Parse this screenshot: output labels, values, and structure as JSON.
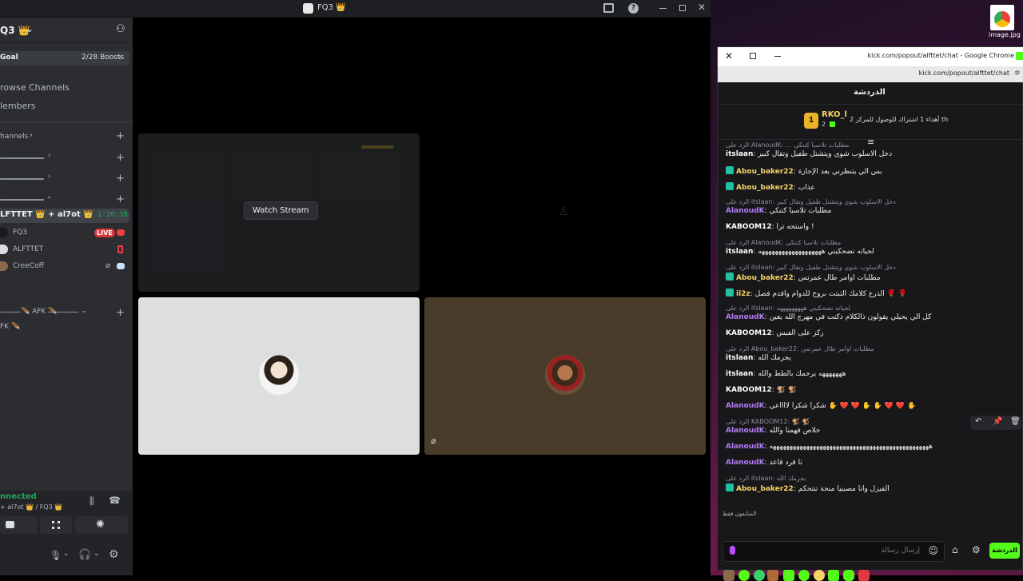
{
  "discord": {
    "window_title": "FQ3 👑",
    "server_name": "Q3 👑",
    "goal_label": "Goal",
    "boosts_label": "2/28 Boosts",
    "browse_channels": "rowse Channels",
    "members": "lembers",
    "channels_header": "hannels",
    "afk_header": "🪶 AFK 🪶",
    "afk_channel": "FK 🪶",
    "voice_channel": {
      "name": "LFTTET 👑 + al7ot 👑",
      "timer": "1:20:38",
      "members": [
        {
          "name": "FQ3",
          "live": "LIVE"
        },
        {
          "name": "ALFTTET"
        },
        {
          "name": "CreeCoff"
        }
      ]
    },
    "connection": {
      "status": "nnected",
      "detail": "+ al7ot 👑 / FQ3 👑"
    },
    "watch_stream": "Watch Stream"
  },
  "desktop": {
    "file_label": "image.jpg"
  },
  "chrome": {
    "window_title": "kick.com/popout/alfttet/chat - Google Chrome",
    "url": "kick.com/popout/alfttet/chat",
    "chat_title": "الدردشة",
    "pinned_user": "RKO_l",
    "pinned_rank": "1",
    "pinned_count": "2",
    "pinned_text": "أهداء 1 اشتراك للوصول للمركز 2 th",
    "messages": [
      {
        "type": "reply",
        "text": "الرد على AlanoudK: ... مطلبات تلاسبا كتنكي"
      },
      {
        "type": "msg",
        "user": "itslaan",
        "color": "#ffffff",
        "text": "دخل الاسلوب شوي ويتشتل طفيل وتقال كبير"
      },
      {
        "type": "msg",
        "user": "Abou_baker22",
        "color": "#f6d365",
        "badge": true,
        "text": "بس الي يتنظرني بعد الإجازة"
      },
      {
        "type": "msg",
        "user": "Abou_baker22",
        "color": "#f6d365",
        "badge": true,
        "text": "عذاب"
      },
      {
        "type": "reply",
        "text": "الرد على itslaan: دخل الاسلوب شوي ويتشتل طفيل وتقال كبير"
      },
      {
        "type": "msg",
        "user": "AlanoudK",
        "color": "#b27cf5",
        "text": "مطلبات تلاسبا كتنكي"
      },
      {
        "type": "msg",
        "user": "KABOOM12",
        "color": "#ffffff",
        "text": "واستحه ترا !"
      },
      {
        "type": "reply",
        "text": "الرد على AlanoudK: مطلبات تلاسبا كتنكي"
      },
      {
        "type": "msg",
        "user": "itslaan",
        "color": "#ffffff",
        "text": "لحياته تضحكيني هههههههههههههههههههه"
      },
      {
        "type": "reply",
        "text": "الرد على itslaan: دخل الاسلوب شوي ويتشتل طفيل وتقال كبير"
      },
      {
        "type": "msg",
        "user": "Abou_baker22",
        "color": "#f6d365",
        "badge": true,
        "text": "مطلبات اوامر طال عمرتس"
      },
      {
        "type": "msg",
        "user": "ii2z",
        "color": "#f6d365",
        "badge": true,
        "text": "الذرع كلامك الثبتت بروح للدوام واقدم فصل 🌹 🌹"
      },
      {
        "type": "reply",
        "text": "الرد على itslaan: لحياته تضحكيني هههههههههه"
      },
      {
        "type": "msg",
        "user": "AlanoudK",
        "color": "#b27cf5",
        "text": "كل الي يحيلي يقولون ذالكلام ذكتت في مهرج الله يعين"
      },
      {
        "type": "msg",
        "user": "KABOOM12",
        "color": "#ffffff",
        "text": "ركز على الفيس"
      },
      {
        "type": "reply",
        "text": "الرد على Abou_baker22: مطلبات اوامر طال عمرتس"
      },
      {
        "type": "msg",
        "user": "itslaan",
        "color": "#ffffff",
        "text": "يحرمك الله"
      },
      {
        "type": "msg",
        "user": "itslaan",
        "color": "#ffffff",
        "text": "هههههههه يرحمك بالطط والله"
      },
      {
        "type": "msg",
        "user": "KABOOM12",
        "color": "#ffffff",
        "text": "🐒 🐒"
      },
      {
        "type": "msg",
        "user": "AlanoudK",
        "color": "#b27cf5",
        "text": "شكراً شكراً لااااعي ✋ ❤️ ❤️ ✋ ✋ ❤️ ❤️ ✋"
      },
      {
        "type": "reply",
        "text": "الرد على KABOOM12: 🐒 🐒"
      },
      {
        "type": "msg",
        "user": "AlanoudK",
        "color": "#b27cf5",
        "text": "خلاص فهمنا والله"
      },
      {
        "type": "msg",
        "user": "AlanoudK",
        "color": "#b27cf5",
        "text": "ههههههههههههههههههههههههههههههههههههههههههههههههه"
      },
      {
        "type": "msg",
        "user": "AlanoudK",
        "color": "#b27cf5",
        "text": "تا قرد قاعد"
      },
      {
        "type": "reply",
        "text": "الرد على itslaan: يحرمك الله"
      },
      {
        "type": "msg",
        "user": "Abou_baker22",
        "color": "#f6d365",
        "badge": true,
        "text": "الفيزل وانا مصبنيا منحة تنتحكم"
      }
    ],
    "emote_label": "المتابعون فقط",
    "input_placeholder": "إرسال رسالة",
    "send_label": "الدردشة"
  }
}
